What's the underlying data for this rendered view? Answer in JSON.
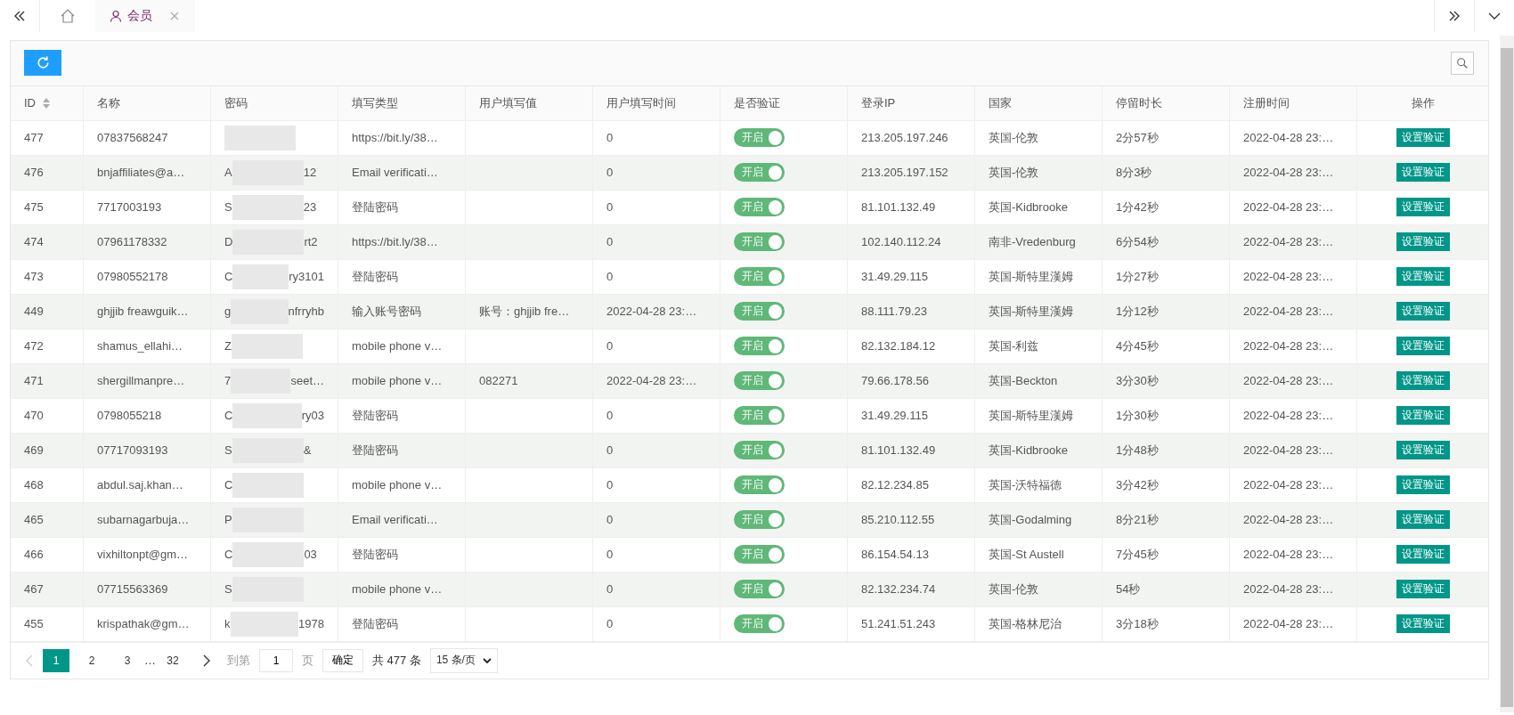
{
  "tabs": [
    {
      "label": "会员",
      "selected": true
    }
  ],
  "table": {
    "columns": [
      {
        "label": "ID",
        "sortable": true
      },
      {
        "label": "名称"
      },
      {
        "label": "密码"
      },
      {
        "label": "填写类型"
      },
      {
        "label": "用户填写值"
      },
      {
        "label": "用户填写时间"
      },
      {
        "label": "是否验证"
      },
      {
        "label": "登录IP"
      },
      {
        "label": "国家"
      },
      {
        "label": "停留时长"
      },
      {
        "label": "注册时间"
      },
      {
        "label": "操作"
      }
    ],
    "rows": [
      {
        "id": "477",
        "name": "07837568247",
        "fill_type": "https://bit.ly/38…",
        "fill_time": "0",
        "verify": {
          "label": "开启",
          "on": true
        },
        "ip": "213.205.197.246",
        "country": "英国-伦敦",
        "stay": "2分57秒",
        "registered": "2022-04-28 23:…",
        "action": "设置验证"
      },
      {
        "id": "476",
        "name": "bnjaffiliates@a…",
        "password_start": "A",
        "password_end": "12",
        "fill_type": "Email verificati…",
        "fill_time": "0",
        "verify": {
          "label": "开启",
          "on": true
        },
        "ip": "213.205.197.152",
        "country": "英国-伦敦",
        "stay": "8分3秒",
        "registered": "2022-04-28 23:…",
        "action": "设置验证"
      },
      {
        "id": "475",
        "name": "7717003193",
        "password_start": "S",
        "password_end": "23",
        "fill_type": "登陆密码",
        "fill_time": "0",
        "verify": {
          "label": "开启",
          "on": true
        },
        "ip": "81.101.132.49",
        "country": "英国-Kidbrooke",
        "stay": "1分42秒",
        "registered": "2022-04-28 23:…",
        "action": "设置验证"
      },
      {
        "id": "474",
        "name": "07961178332",
        "password_start": "D",
        "password_end": "rt2",
        "fill_type": "https://bit.ly/38…",
        "fill_time": "0",
        "verify": {
          "label": "开启",
          "on": true
        },
        "ip": "102.140.112.24",
        "country": "南非-Vredenburg",
        "stay": "6分54秒",
        "registered": "2022-04-28 23:…",
        "action": "设置验证"
      },
      {
        "id": "473",
        "name": "07980552178",
        "password_start": "C",
        "password_end": "ry3101",
        "fill_type": "登陆密码",
        "fill_time": "0",
        "verify": {
          "label": "开启",
          "on": true
        },
        "ip": "31.49.29.115",
        "country": "英国-斯特里漢姆",
        "stay": "1分27秒",
        "registered": "2022-04-28 23:…",
        "action": "设置验证"
      },
      {
        "id": "449",
        "name": "ghjjib freawguik…",
        "password_start": "g",
        "password_end": "nfrryhb",
        "fill_type": "输入账号密码",
        "fill_value": "账号：ghjjib fre…",
        "fill_time": "2022-04-28 23:…",
        "verify": {
          "label": "开启",
          "on": true
        },
        "ip": "88.111.79.23",
        "country": "英国-斯特里漢姆",
        "stay": "1分12秒",
        "registered": "2022-04-28 23:…",
        "action": "设置验证"
      },
      {
        "id": "472",
        "name": "shamus_ellahi…",
        "password_start": "Z",
        "fill_type": "mobile phone v…",
        "fill_time": "0",
        "verify": {
          "label": "开启",
          "on": true
        },
        "ip": "82.132.184.12",
        "country": "英国-利兹",
        "stay": "4分45秒",
        "registered": "2022-04-28 23:…",
        "action": "设置验证"
      },
      {
        "id": "471",
        "name": "shergillmanpre…",
        "password_start": "7",
        "password_end": "seet…",
        "fill_type": "mobile phone v…",
        "fill_value": "082271",
        "fill_time": "2022-04-28 23:…",
        "verify": {
          "label": "开启",
          "on": true
        },
        "ip": "79.66.178.56",
        "country": "英国-Beckton",
        "stay": "3分30秒",
        "registered": "2022-04-28 23:…",
        "action": "设置验证"
      },
      {
        "id": "470",
        "name": "0798055218",
        "password_start": "C",
        "password_end": "ry03",
        "fill_type": "登陆密码",
        "fill_time": "0",
        "verify": {
          "label": "开启",
          "on": true
        },
        "ip": "31.49.29.115",
        "country": "英国-斯特里漢姆",
        "stay": "1分30秒",
        "registered": "2022-04-28 23:…",
        "action": "设置验证"
      },
      {
        "id": "469",
        "name": "07717093193",
        "password_start": "S",
        "password_end": "&",
        "fill_type": "登陆密码",
        "fill_time": "0",
        "verify": {
          "label": "开启",
          "on": true
        },
        "ip": "81.101.132.49",
        "country": "英国-Kidbrooke",
        "stay": "1分48秒",
        "registered": "2022-04-28 23:…",
        "action": "设置验证"
      },
      {
        "id": "468",
        "name": "abdul.saj.khan…",
        "password_start": "C",
        "fill_type": "mobile phone v…",
        "fill_time": "0",
        "verify": {
          "label": "开启",
          "on": true
        },
        "ip": "82.12.234.85",
        "country": "英国-沃特福德",
        "stay": "3分42秒",
        "registered": "2022-04-28 23:…",
        "action": "设置验证"
      },
      {
        "id": "465",
        "name": "subarnagarbuja…",
        "password_start": "P",
        "fill_type": "Email verificati…",
        "fill_time": "0",
        "verify": {
          "label": "开启",
          "on": true
        },
        "ip": "85.210.112.55",
        "country": "英国-Godalming",
        "stay": "8分21秒",
        "registered": "2022-04-28 23:…",
        "action": "设置验证"
      },
      {
        "id": "466",
        "name": "vixhiltonpt@gm…",
        "password_start": "C",
        "password_end": "03",
        "fill_type": "登陆密码",
        "fill_time": "0",
        "verify": {
          "label": "开启",
          "on": true
        },
        "ip": "86.154.54.13",
        "country": "英国-St Austell",
        "stay": "7分45秒",
        "registered": "2022-04-28 23:…",
        "action": "设置验证"
      },
      {
        "id": "467",
        "name": "07715563369",
        "password_start": "S",
        "fill_type": "mobile phone v…",
        "fill_time": "0",
        "verify": {
          "label": "开启",
          "on": true
        },
        "ip": "82.132.234.74",
        "country": "英国-伦敦",
        "stay": "54秒",
        "registered": "2022-04-28 23:…",
        "action": "设置验证"
      },
      {
        "id": "455",
        "name": "krispathak@gm…",
        "password_start": "k",
        "password_end": "1978",
        "fill_type": "登陆密码",
        "fill_time": "0",
        "verify": {
          "label": "开启",
          "on": true
        },
        "ip": "51.241.51.243",
        "country": "英国-格林尼治",
        "stay": "3分18秒",
        "registered": "2022-04-28 23:…",
        "action": "设置验证"
      }
    ]
  },
  "pagination": {
    "pages": [
      {
        "label": "1",
        "selected": true
      },
      {
        "label": "2",
        "selected": false
      },
      {
        "label": "3",
        "selected": false
      },
      {
        "label": "…",
        "kind": "ellipsis"
      },
      {
        "label": "32",
        "selected": false
      }
    ],
    "goto_label": "到第",
    "goto_value": "1",
    "page_unit": "页",
    "confirm": "确定",
    "total": "共 477 条",
    "page_size": "15 条/页"
  }
}
